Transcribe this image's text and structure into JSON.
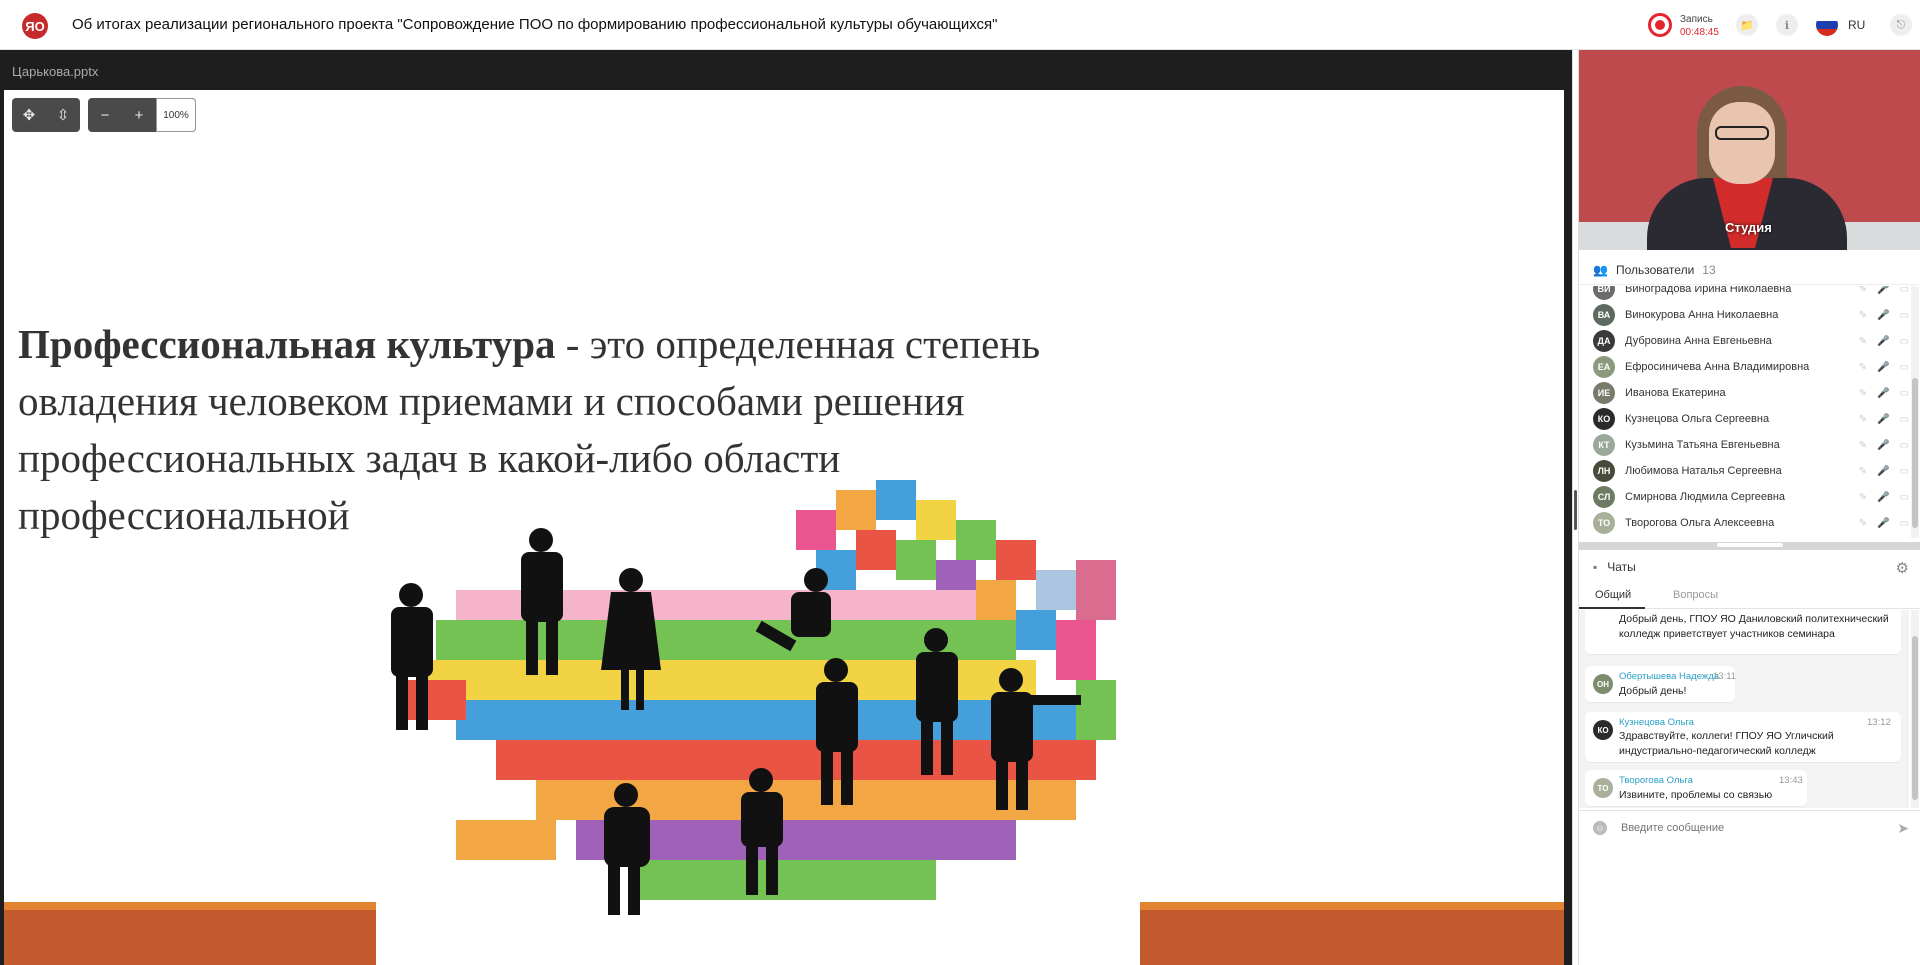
{
  "header": {
    "logo_text": "ЯО",
    "title": "Об итогах реализации регионального проекта \"Сопровождение ПОО по формированию профессиональной культуры обучающихся\"",
    "record_label": "Запись",
    "record_time": "00:48:45",
    "folder_icon": "📁",
    "info_icon": "ℹ",
    "lang": "RU",
    "exit_icon": "⎋"
  },
  "presentation": {
    "filename": "Царькова.pptx",
    "zoom": "100%",
    "tool_icons": {
      "move": "✥",
      "fit": "⇳",
      "minus": "−",
      "plus": "+"
    },
    "slide_bold": "Профессиональная культура",
    "slide_rest": " - это определенная степень овладения человеком приемами и способами решения профессиональных задач в какой-либо области профессиональной"
  },
  "video": {
    "label": "Студия"
  },
  "users": {
    "title": "Пользователи",
    "count": "13",
    "icon": "👥",
    "list": [
      {
        "initials": "ВИ",
        "name": "Виноградова Ирина Николаевна",
        "color": "#6b6b6b"
      },
      {
        "initials": "ВА",
        "name": "Винокурова Анна Николаевна",
        "color": "#5c6a60"
      },
      {
        "initials": "ДА",
        "name": "Дубровина Анна Евгеньевна",
        "color": "#3a3a3a"
      },
      {
        "initials": "ЕА",
        "name": "Ефросиничева Анна Владимировна",
        "color": "#8a9a7a"
      },
      {
        "initials": "ИЕ",
        "name": "Иванова Екатерина",
        "color": "#7a7a6a"
      },
      {
        "initials": "КО",
        "name": "Кузнецова Ольга Сергеевна",
        "color": "#2b2b2b"
      },
      {
        "initials": "КТ",
        "name": "Кузьмина Татьяна Евгеньевна",
        "color": "#9aa89a"
      },
      {
        "initials": "ЛН",
        "name": "Любимова Наталья Сергеевна",
        "color": "#4a4a3a"
      },
      {
        "initials": "СЛ",
        "name": "Смирнова Людмила Сергеевна",
        "color": "#6e7a62"
      },
      {
        "initials": "ТО",
        "name": "Творогова Ольга Алексеевна",
        "color": "#a8b09a"
      }
    ]
  },
  "chats": {
    "title": "Чаты",
    "tabs": [
      "Общий",
      "Вопросы"
    ],
    "messages": [
      {
        "author": "",
        "initials": "",
        "time": "",
        "text": "Добрый день, ГПОУ ЯО Даниловский политехнический колледж приветствует участников семинара",
        "color": "#5c6a60"
      },
      {
        "author": "Обертышева Надежда",
        "initials": "ОН",
        "time": "13:11",
        "text": "Добрый день!",
        "color": "#7d8c6c"
      },
      {
        "author": "Кузнецова Ольга",
        "initials": "КО",
        "time": "13:12",
        "text": "Здравствуйте, коллеги! ГПОУ ЯО Угличский индустриально-педагогический колледж",
        "color": "#2b2b2b"
      },
      {
        "author": "Творогова Ольга",
        "initials": "ТО",
        "time": "13:43",
        "text": "Извините, проблемы со связью",
        "color": "#a8b09a"
      }
    ],
    "input_placeholder": "Введите сообщение"
  }
}
